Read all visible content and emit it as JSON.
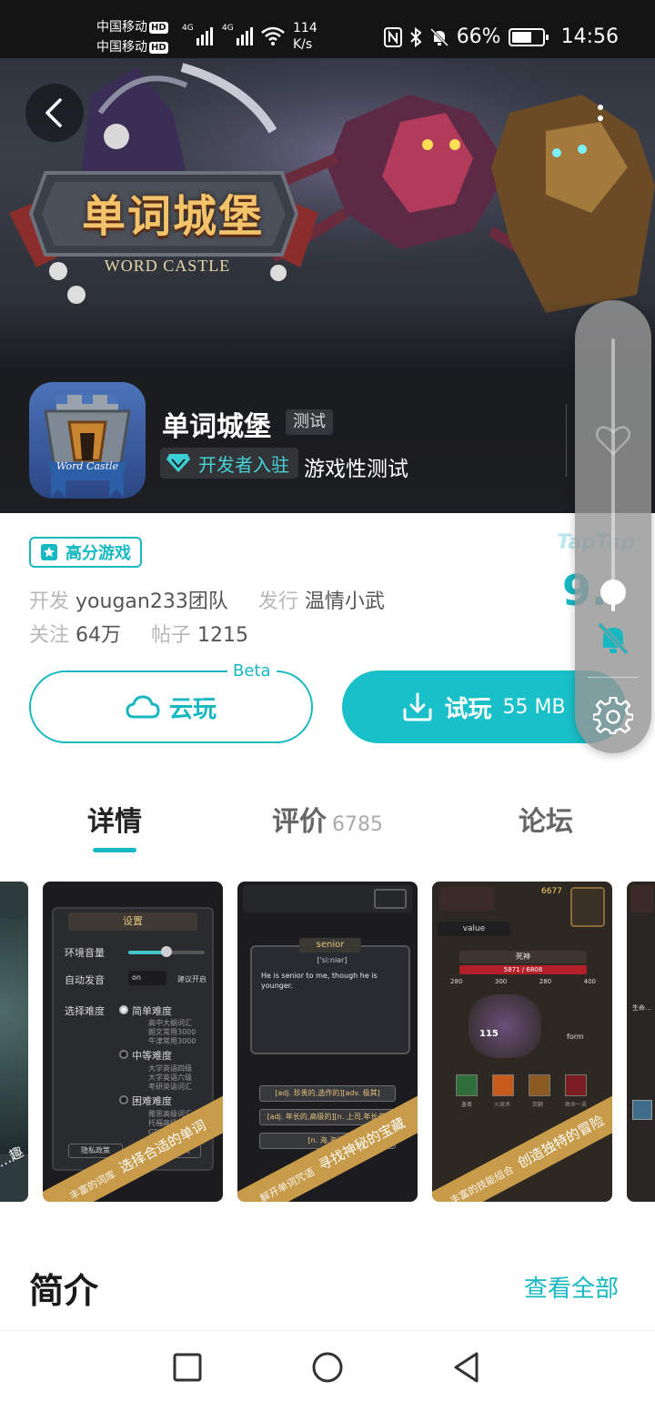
{
  "status_bar": {
    "carrier_1": "中国移动",
    "carrier_2": "中国移动",
    "hd_badge": "HD",
    "network_type": "4G",
    "speed_value": "114",
    "speed_unit": "K/s",
    "battery": "66%",
    "time": "14:56"
  },
  "banner": {
    "logo_cn": "单词城堡",
    "logo_en": "WORD CASTLE"
  },
  "app": {
    "icon_label": "Word Castle",
    "title": "单词城堡",
    "test_tag": "测试",
    "dev_badge": "开发者入驻",
    "dev_suffix": "游戏性测试"
  },
  "info": {
    "score_tag": "高分游戏",
    "developer_label": "开发",
    "developer": "yougan233团队",
    "publisher_label": "发行",
    "publisher": "温情小武",
    "follow_label": "关注",
    "follow": "64万",
    "posts_label": "帖子",
    "posts": "1215",
    "brand": "TapTap",
    "rating_partial": "9."
  },
  "actions": {
    "cloud_label": "云玩",
    "beta": "Beta",
    "trial_label": "试玩",
    "trial_size": "55 MB"
  },
  "volume_panel": {
    "level": 0.07
  },
  "tabs": [
    {
      "label": "详情",
      "count": ""
    },
    {
      "label": "评价",
      "count": "6785"
    },
    {
      "label": "论坛",
      "count": ""
    }
  ],
  "screenshots": [
    {
      "caption": "…趣"
    },
    {
      "caption_small": "丰富的词库",
      "caption": "选择合适的单词",
      "settings": {
        "title": "设置",
        "volume_label": "环境音量",
        "autoplay_label": "自动发音",
        "autoplay_value": "on",
        "autoplay_hint": "建议开启",
        "difficulty_label": "选择难度",
        "easy": "简单难度",
        "easy_items": [
          "高中大纲词汇",
          "朗文常用3000",
          "牛津常用3000"
        ],
        "medium": "中等难度",
        "medium_items": [
          "大学英语四级",
          "大学英语六级",
          "考研英语词汇"
        ],
        "hard": "困难难度",
        "hard_items": [
          "雅思高级词汇",
          "托福高级词汇",
          "GRE高级词汇"
        ],
        "privacy": "隐私政策",
        "restore": "恢复已购买"
      }
    },
    {
      "caption_small": "解开单词咒语",
      "caption": "寻找神秘的宝藏",
      "quiz": {
        "word": "senior",
        "phonetic": "['siːniər]",
        "sentence": "He is senior to me, though he is younger.",
        "options": [
          "[adj. 珍贵的,选作的][adv. 极其]",
          "[adj. 年长的,高级的][n. 上司,年长者]",
          "[n. 海,海洋]"
        ]
      }
    },
    {
      "caption_small": "丰富的技能组合",
      "caption": "创造独特的冒险",
      "battle": {
        "gold": "6677",
        "value_label": "value",
        "boss": "死神",
        "boss_hp": "5871 / 6808",
        "damage": "115",
        "form_label": "form",
        "stats": [
          "280",
          "300",
          "280",
          "400"
        ],
        "skills": [
          "蛊毒",
          "火球术",
          "荧翻",
          "致命一击"
        ]
      }
    },
    {
      "caption": "生命…"
    }
  ],
  "intro": {
    "title": "简介",
    "view_all": "查看全部"
  }
}
